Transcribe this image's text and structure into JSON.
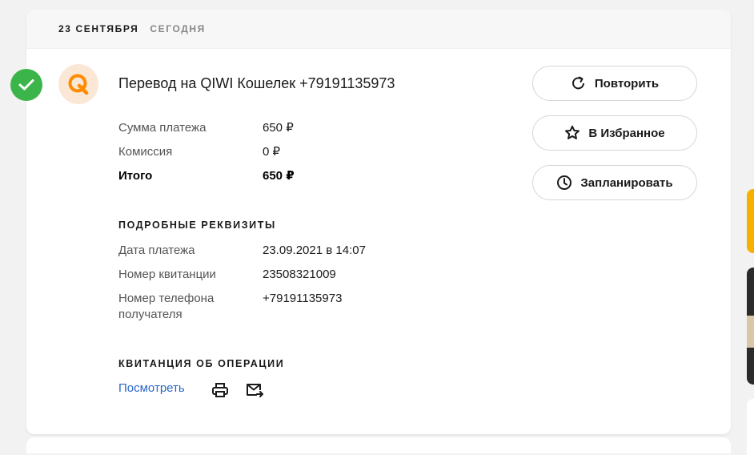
{
  "header": {
    "date": "23 СЕНТЯБРЯ",
    "today": "СЕГОДНЯ"
  },
  "payment": {
    "title": "Перевод на QIWI Кошелек +79191135973",
    "provider_icon": "qiwi-logo",
    "status_icon": "check-icon",
    "status_color": "#3bb54a"
  },
  "amounts": [
    {
      "label": "Сумма платежа",
      "value": "650 ₽"
    },
    {
      "label": "Комиссия",
      "value": "0 ₽"
    },
    {
      "label": "Итого",
      "value": "650 ₽"
    }
  ],
  "details": {
    "title": "ПОДРОБНЫЕ РЕКВИЗИТЫ",
    "rows": [
      {
        "label": "Дата платежа",
        "value": "23.09.2021 в 14:07"
      },
      {
        "label": "Номер квитанции",
        "value": "23508321009"
      },
      {
        "label": "Номер телефона получателя",
        "value": "+79191135973"
      }
    ]
  },
  "receipt": {
    "title": "КВИТАНЦИЯ ОБ ОПЕРАЦИИ",
    "view_label": "Посмотреть",
    "print_icon": "print-icon",
    "email_icon": "email-icon"
  },
  "actions": {
    "repeat_label": "Повторить",
    "favorite_label": "В Избранное",
    "schedule_label": "Запланировать"
  },
  "colors": {
    "accent_link": "#2a67c7",
    "success": "#3bb54a",
    "qiwi_orange": "#ff8c00"
  }
}
